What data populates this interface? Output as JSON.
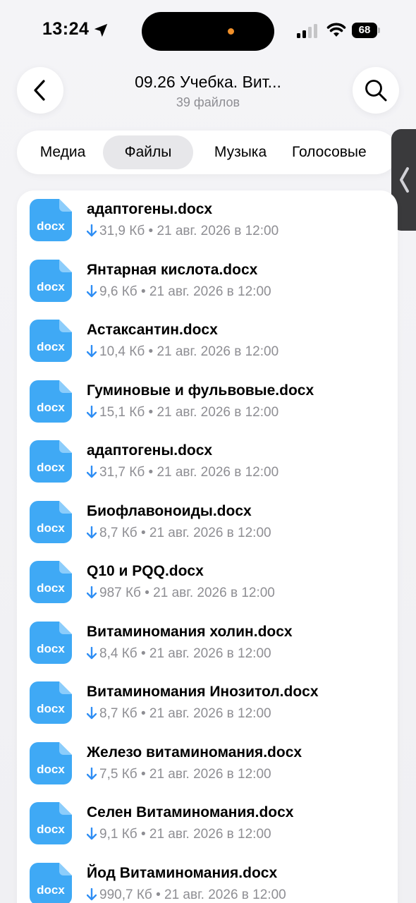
{
  "status_bar": {
    "time": "13:24",
    "battery": "68"
  },
  "header": {
    "title": "09.26 Учебка. Вит...",
    "subtitle": "39 файлов"
  },
  "tabs": [
    {
      "label": "Медиа",
      "selected": false
    },
    {
      "label": "Файлы",
      "selected": true
    },
    {
      "label": "Музыка",
      "selected": false
    },
    {
      "label": "Голосовые",
      "selected": false
    }
  ],
  "files": [
    {
      "icon_label": "docx",
      "name": "адаптогены.docx",
      "size": "31,9 Кб",
      "date": "21 авг. 2026 в 12:00"
    },
    {
      "icon_label": "docx",
      "name": "Янтарная кислота.docx",
      "size": "9,6 Кб",
      "date": "21 авг. 2026 в 12:00"
    },
    {
      "icon_label": "docx",
      "name": "Астаксантин.docx",
      "size": "10,4 Кб",
      "date": "21 авг. 2026 в 12:00"
    },
    {
      "icon_label": "docx",
      "name": "Гуминовые и фульвовые.docx",
      "size": "15,1 Кб",
      "date": "21 авг. 2026 в 12:00"
    },
    {
      "icon_label": "docx",
      "name": "адаптогены.docx",
      "size": "31,7 Кб",
      "date": "21 авг. 2026 в 12:00"
    },
    {
      "icon_label": "docx",
      "name": "Биофлавоноиды.docx",
      "size": "8,7 Кб",
      "date": "21 авг. 2026 в 12:00"
    },
    {
      "icon_label": "docx",
      "name": "Q10 и PQQ.docx",
      "size": "987 Кб",
      "date": "21 авг. 2026 в 12:00"
    },
    {
      "icon_label": "docx",
      "name": "Витаминомания холин.docx",
      "size": "8,4 Кб",
      "date": "21 авг. 2026 в 12:00"
    },
    {
      "icon_label": "docx",
      "name": "Витаминомания Инозитол.docx",
      "size": "8,7 Кб",
      "date": "21 авг. 2026 в 12:00"
    },
    {
      "icon_label": "docx",
      "name": "Железо витаминомания.docx",
      "size": "7,5 Кб",
      "date": "21 авг. 2026 в 12:00"
    },
    {
      "icon_label": "docx",
      "name": "Селен Витаминомания.docx",
      "size": "9,1 Кб",
      "date": "21 авг. 2026 в 12:00"
    },
    {
      "icon_label": "docx",
      "name": "Йод Витаминомания.docx",
      "size": "990,7 Кб",
      "date": "21 авг. 2026 в 12:00"
    }
  ],
  "meta_separator": "•",
  "colors": {
    "doc_icon": "#3fa9f5",
    "accent": "#2f8ef4",
    "secondary_text": "#8e8e93"
  },
  "icons": {
    "back": "chevron-left-icon",
    "search": "search-icon",
    "download": "download-arrow-icon",
    "file": "docx-file-icon"
  }
}
